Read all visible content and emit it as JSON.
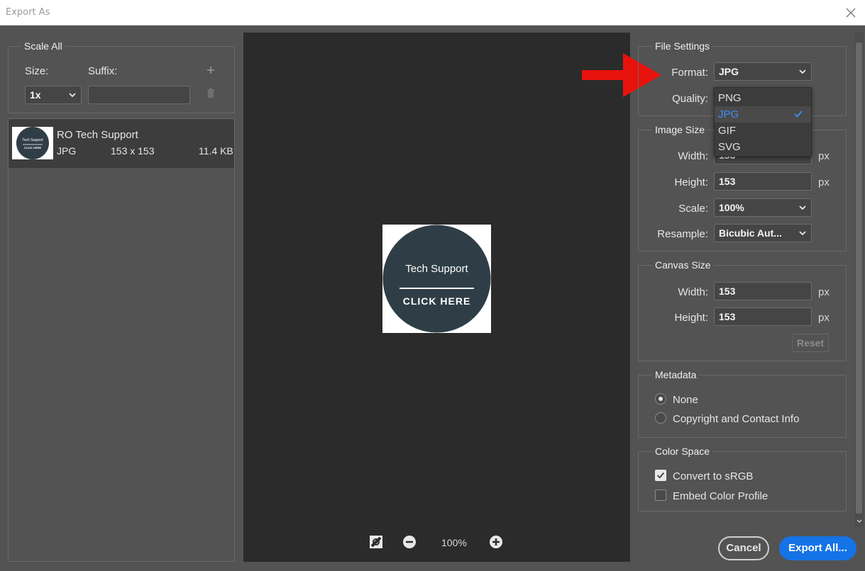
{
  "window": {
    "title": "Export As"
  },
  "left": {
    "scale_all_title": "Scale All",
    "size_label": "Size:",
    "suffix_label": "Suffix:",
    "size_value": "1x",
    "suffix_value": "",
    "asset": {
      "name": "RO Tech Support",
      "format": "JPG",
      "dimensions": "153 x 153",
      "filesize": "11.4 KB"
    }
  },
  "preview": {
    "image_text_top": "Tech Support",
    "image_text_bottom": "CLICK HERE",
    "zoom": "100%",
    "thumb_text_top": "Tech Support",
    "thumb_text_bottom": "CLICK HERE"
  },
  "file_settings": {
    "title": "File Settings",
    "format_label": "Format:",
    "format_value": "JPG",
    "quality_label": "Quality:",
    "dropdown_options": [
      "PNG",
      "JPG",
      "GIF",
      "SVG"
    ],
    "selected_option": "JPG"
  },
  "image_size": {
    "title": "Image Size",
    "width_label": "Width:",
    "width_value": "153",
    "height_label": "Height:",
    "height_value": "153",
    "scale_label": "Scale:",
    "scale_value": "100%",
    "resample_label": "Resample:",
    "resample_value": "Bicubic Aut...",
    "unit": "px"
  },
  "canvas_size": {
    "title": "Canvas Size",
    "width_label": "Width:",
    "width_value": "153",
    "height_label": "Height:",
    "height_value": "153",
    "unit": "px",
    "reset_label": "Reset"
  },
  "metadata": {
    "title": "Metadata",
    "options": [
      "None",
      "Copyright and Contact Info"
    ],
    "selected": "None"
  },
  "color_space": {
    "title": "Color Space",
    "convert_label": "Convert to sRGB",
    "convert_checked": true,
    "embed_label": "Embed Color Profile",
    "embed_checked": false
  },
  "footer": {
    "cancel_label": "Cancel",
    "export_label": "Export All..."
  },
  "colors": {
    "accent": "#1473e6",
    "selected_text": "#3d8ff5",
    "arrow": "#e8120c",
    "logo_circle": "#2f3e46"
  }
}
